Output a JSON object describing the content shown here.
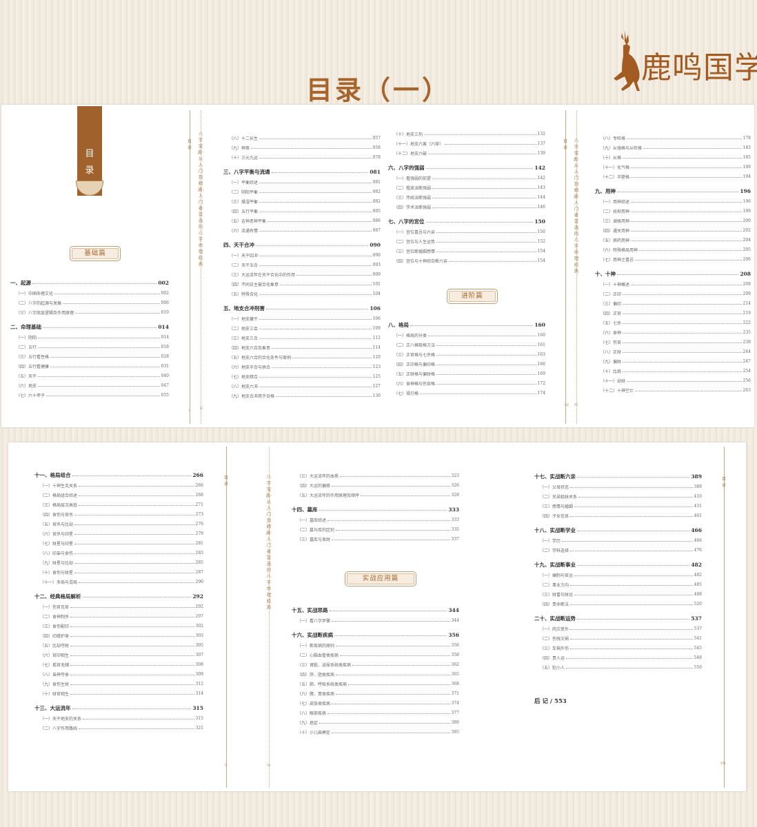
{
  "brand": {
    "name": "鹿鸣国学",
    "logo": "deer-logo-icon"
  },
  "page_title": "目录（一）",
  "category_tab": {
    "line1": "目",
    "line2": "录"
  },
  "spine_tag": "目录",
  "spine_text": "八字宝典·从入门到精通·入门者首选的八字命理经典",
  "page_numbers": [
    "I",
    "II",
    "III",
    "IV",
    "V",
    "VI",
    "VII"
  ],
  "section_badges": {
    "basic": "基础篇",
    "advanced": "进阶篇",
    "practical": "实战应用篇"
  },
  "col1": [
    {
      "t": "h",
      "label": "一、起源",
      "page": "002"
    },
    {
      "t": "s",
      "label": "（一）中国命理文化",
      "page": "002"
    },
    {
      "t": "s",
      "label": "（二）八字的起源与发展",
      "page": "006"
    },
    {
      "t": "s",
      "label": "（三）八字底层逻辑及作用原理",
      "page": "010"
    },
    {
      "t": "h",
      "label": "二、命理基础",
      "page": "014"
    },
    {
      "t": "s",
      "label": "（一）阴阳",
      "page": "014"
    },
    {
      "t": "s",
      "label": "（二）五行",
      "page": "018"
    },
    {
      "t": "s",
      "label": "（三）五行看性格",
      "page": "028"
    },
    {
      "t": "s",
      "label": "（四）五行看健康",
      "page": "031"
    },
    {
      "t": "s",
      "label": "（五）天干",
      "page": "040"
    },
    {
      "t": "s",
      "label": "（六）地支",
      "page": "047"
    },
    {
      "t": "s",
      "label": "（七）六十甲子",
      "page": "055"
    }
  ],
  "col2": [
    {
      "t": "s",
      "label": "（八）十二长生",
      "page": "057"
    },
    {
      "t": "s",
      "label": "（九）神煞",
      "page": "058"
    },
    {
      "t": "s",
      "label": "（十）三元九运",
      "page": "078"
    },
    {
      "t": "h",
      "label": "三、八字平衡与流通",
      "page": "081"
    },
    {
      "t": "s",
      "label": "（一）平衡综述",
      "page": "081"
    },
    {
      "t": "s",
      "label": "（二）阴阳平衡",
      "page": "082"
    },
    {
      "t": "s",
      "label": "（三）燥湿平衡",
      "page": "082"
    },
    {
      "t": "s",
      "label": "（四）五行平衡",
      "page": "085"
    },
    {
      "t": "s",
      "label": "（五）吉神恶神平衡",
      "page": "086"
    },
    {
      "t": "s",
      "label": "（六）流通有情",
      "page": "087"
    },
    {
      "t": "h",
      "label": "四、天干合冲",
      "page": "090"
    },
    {
      "t": "s",
      "label": "（一）天干四冲",
      "page": "090"
    },
    {
      "t": "s",
      "label": "（二）天干五合",
      "page": "093"
    },
    {
      "t": "s",
      "label": "（三）大运流年在天干合化中的作用",
      "page": "099"
    },
    {
      "t": "s",
      "label": "（四）不同日主被合化象意",
      "page": "101"
    },
    {
      "t": "s",
      "label": "（五）特殊合化",
      "page": "104"
    },
    {
      "t": "h",
      "label": "五、地支合冲刑害",
      "page": "106"
    },
    {
      "t": "s",
      "label": "（一）地支藏干",
      "page": "106"
    },
    {
      "t": "s",
      "label": "（二）地支三会",
      "page": "109"
    },
    {
      "t": "s",
      "label": "（三）地支三合",
      "page": "112"
    },
    {
      "t": "s",
      "label": "（四）地支六合及象意",
      "page": "114"
    },
    {
      "t": "s",
      "label": "（五）地支六合的合化条件与案例",
      "page": "120"
    },
    {
      "t": "s",
      "label": "（六）地支半合与拱合",
      "page": "123"
    },
    {
      "t": "s",
      "label": "（七）地支暗合",
      "page": "125"
    },
    {
      "t": "s",
      "label": "（八）地支六冲",
      "page": "127"
    },
    {
      "t": "s",
      "label": "（九）地支合冲用于合格",
      "page": "130"
    }
  ],
  "col3a": [
    {
      "t": "s",
      "label": "（十）地支三刑",
      "page": "132"
    },
    {
      "t": "s",
      "label": "（十一）地支六害（六穿）",
      "page": "137"
    },
    {
      "t": "s",
      "label": "（十二）地支六破",
      "page": "139"
    },
    {
      "t": "h",
      "label": "六、八字的强弱",
      "page": "142"
    },
    {
      "t": "s",
      "label": "（一）看强弱的前提",
      "page": "142"
    },
    {
      "t": "s",
      "label": "（二）粗放派断强弱",
      "page": "143"
    },
    {
      "t": "s",
      "label": "（三）传统派断强弱",
      "page": "144"
    },
    {
      "t": "s",
      "label": "（四）学术派断强弱",
      "page": "146"
    },
    {
      "t": "h",
      "label": "七、八字的宫位",
      "page": "150"
    },
    {
      "t": "s",
      "label": "（一）宫位喜忌与六亲",
      "page": "150"
    },
    {
      "t": "s",
      "label": "（二）宫位与人生运势",
      "page": "152"
    },
    {
      "t": "s",
      "label": "（三）宫位断婚姻感情",
      "page": "154"
    },
    {
      "t": "s",
      "label": "（四）宫位与十神综合断六亲",
      "page": "154"
    }
  ],
  "col3b": [
    {
      "t": "h",
      "label": "八、格局",
      "page": "160"
    },
    {
      "t": "s",
      "label": "（一）格局的分类",
      "page": "160"
    },
    {
      "t": "s",
      "label": "（二）正八格取格方法",
      "page": "161"
    },
    {
      "t": "s",
      "label": "（三）正官格与七杀格",
      "page": "163"
    },
    {
      "t": "s",
      "label": "（四）正印格与偏印格",
      "page": "166"
    },
    {
      "t": "s",
      "label": "（五）正财格与偏财格",
      "page": "169"
    },
    {
      "t": "s",
      "label": "（六）食神格与伤官格",
      "page": "172"
    },
    {
      "t": "s",
      "label": "（七）禄刃格",
      "page": "174"
    }
  ],
  "col4": [
    {
      "t": "s",
      "label": "（八）专旺格",
      "page": "178"
    },
    {
      "t": "s",
      "label": "（九）从强格与从旺格",
      "page": "183"
    },
    {
      "t": "s",
      "label": "（十）从格",
      "page": "185"
    },
    {
      "t": "s",
      "label": "（十一）化气格",
      "page": "189"
    },
    {
      "t": "s",
      "label": "（十二）半壁格",
      "page": "194"
    },
    {
      "t": "h",
      "label": "九、用神",
      "page": "196"
    },
    {
      "t": "s",
      "label": "（一）用神综述",
      "page": "196"
    },
    {
      "t": "s",
      "label": "（二）扶抑用神",
      "page": "199"
    },
    {
      "t": "s",
      "label": "（三）调候用神",
      "page": "200"
    },
    {
      "t": "s",
      "label": "（四）通关用神",
      "page": "202"
    },
    {
      "t": "s",
      "label": "（五）病药用神",
      "page": "204"
    },
    {
      "t": "s",
      "label": "（六）特殊格局用神",
      "page": "205"
    },
    {
      "t": "s",
      "label": "（七）用神之喜忌",
      "page": "206"
    },
    {
      "t": "h",
      "label": "十、十神",
      "page": "208"
    },
    {
      "t": "s",
      "label": "（一）十神概述",
      "page": "208"
    },
    {
      "t": "s",
      "label": "（二）正印",
      "page": "209"
    },
    {
      "t": "s",
      "label": "（三）偏印",
      "page": "214"
    },
    {
      "t": "s",
      "label": "（四）正官",
      "page": "219"
    },
    {
      "t": "s",
      "label": "（五）七杀",
      "page": "222"
    },
    {
      "t": "s",
      "label": "（六）食神",
      "page": "235"
    },
    {
      "t": "s",
      "label": "（七）伤官",
      "page": "238"
    },
    {
      "t": "s",
      "label": "（八）正财",
      "page": "244"
    },
    {
      "t": "s",
      "label": "（九）偏财",
      "page": "247"
    },
    {
      "t": "s",
      "label": "（十）比肩",
      "page": "254"
    },
    {
      "t": "s",
      "label": "（十一）劫财",
      "page": "256"
    },
    {
      "t": "s",
      "label": "（十二）十神空亡",
      "page": "263"
    }
  ],
  "col5": [
    {
      "t": "h",
      "label": "十一、格局组合",
      "page": "266"
    },
    {
      "t": "s",
      "label": "（一）十神生克关系",
      "page": "266"
    },
    {
      "t": "s",
      "label": "（二）格局组合综述",
      "page": "268"
    },
    {
      "t": "s",
      "label": "（三）格局层次高低",
      "page": "271"
    },
    {
      "t": "s",
      "label": "（四）食伤与官杀",
      "page": "273"
    },
    {
      "t": "s",
      "label": "（五）官杀与比劫",
      "page": "276"
    },
    {
      "t": "s",
      "label": "（六）官杀与印星",
      "page": "279"
    },
    {
      "t": "s",
      "label": "（七）财星与印星",
      "page": "281"
    },
    {
      "t": "s",
      "label": "（八）印枭与食伤",
      "page": "283"
    },
    {
      "t": "s",
      "label": "（九）财星与比劫",
      "page": "285"
    },
    {
      "t": "s",
      "label": "（十）食伤与财星",
      "page": "287"
    },
    {
      "t": "s",
      "label": "（十一）多局与混局",
      "page": "290"
    },
    {
      "t": "h",
      "label": "十二、经典格局解析",
      "page": "292"
    },
    {
      "t": "s",
      "label": "（一）伤官见官",
      "page": "292"
    },
    {
      "t": "s",
      "label": "（二）食神制杀",
      "page": "297"
    },
    {
      "t": "s",
      "label": "（三）食伤配印",
      "page": "302"
    },
    {
      "t": "s",
      "label": "（四）印绶护身",
      "page": "303"
    },
    {
      "t": "s",
      "label": "（五）比劫夺财",
      "page": "305"
    },
    {
      "t": "s",
      "label": "（六）官印相生",
      "page": "307"
    },
    {
      "t": "s",
      "label": "（七）孤官无辅",
      "page": "308"
    },
    {
      "t": "s",
      "label": "（八）枭神夺食",
      "page": "309"
    },
    {
      "t": "s",
      "label": "（九）食伤生财",
      "page": "312"
    },
    {
      "t": "s",
      "label": "（十）财官相生",
      "page": "314"
    },
    {
      "t": "h",
      "label": "十三、大运流年",
      "page": "315"
    },
    {
      "t": "s",
      "label": "（一）天干地支的关系",
      "page": "315"
    },
    {
      "t": "s",
      "label": "（二）八字作用路线",
      "page": "321"
    }
  ],
  "col6a": [
    {
      "t": "s",
      "label": "（三）大运流年的本质",
      "page": "323"
    },
    {
      "t": "s",
      "label": "（四）大运的偏移",
      "page": "326"
    },
    {
      "t": "s",
      "label": "（五）大运流年的作用原理及顺序",
      "page": "328"
    },
    {
      "t": "h",
      "label": "十四、墓库",
      "page": "333"
    },
    {
      "t": "s",
      "label": "（一）墓库综述",
      "page": "333"
    },
    {
      "t": "s",
      "label": "（二）墓与库的区别",
      "page": "335"
    },
    {
      "t": "s",
      "label": "（三）墓库与发财",
      "page": "337"
    }
  ],
  "col6b": [
    {
      "t": "h",
      "label": "十五、实战思路",
      "page": "344"
    },
    {
      "t": "s",
      "label": "（一）看八字步骤",
      "page": "344"
    },
    {
      "t": "h",
      "label": "十六、实战断疾病",
      "page": "356"
    },
    {
      "t": "s",
      "label": "（一）断疾病的原则",
      "page": "356"
    },
    {
      "t": "s",
      "label": "（二）心脑血管类疾病",
      "page": "358"
    },
    {
      "t": "s",
      "label": "（三）肾脏、泌尿系统类疾病",
      "page": "362"
    },
    {
      "t": "s",
      "label": "（四）肝、胆类疾病",
      "page": "365"
    },
    {
      "t": "s",
      "label": "（五）肺、呼吸系统类疾病",
      "page": "368"
    },
    {
      "t": "s",
      "label": "（六）脾、胃类疾病",
      "page": "371"
    },
    {
      "t": "s",
      "label": "（七）皮肤类疾病",
      "page": "374"
    },
    {
      "t": "s",
      "label": "（八）眼部疾病",
      "page": "377"
    },
    {
      "t": "s",
      "label": "（九）癌症",
      "page": "380"
    },
    {
      "t": "s",
      "label": "（十）小儿麻痹症",
      "page": "385"
    }
  ],
  "col7": [
    {
      "t": "h",
      "label": "十七、实战断六亲",
      "page": "389"
    },
    {
      "t": "s",
      "label": "（一）父母状态",
      "page": "389"
    },
    {
      "t": "s",
      "label": "（二）兄弟姐妹关系",
      "page": "410"
    },
    {
      "t": "s",
      "label": "（三）感情与婚姻",
      "page": "431"
    },
    {
      "t": "s",
      "label": "（四）子女信息",
      "page": "461"
    },
    {
      "t": "h",
      "label": "十八、实战断学业",
      "page": "466"
    },
    {
      "t": "s",
      "label": "（一）学历",
      "page": "466"
    },
    {
      "t": "s",
      "label": "（二）学科选择",
      "page": "476"
    },
    {
      "t": "h",
      "label": "十九、实战断事业",
      "page": "482"
    },
    {
      "t": "s",
      "label": "（一）编制与官运",
      "page": "482"
    },
    {
      "t": "s",
      "label": "（二）事业方向",
      "page": "485"
    },
    {
      "t": "s",
      "label": "（三）财富与财运",
      "page": "488"
    },
    {
      "t": "s",
      "label": "（四）贵命断法",
      "page": "520"
    },
    {
      "t": "h",
      "label": "二十、实战断运势",
      "page": "537"
    },
    {
      "t": "s",
      "label": "（一）肉灾意外",
      "page": "537"
    },
    {
      "t": "s",
      "label": "（二）伤残灾祸",
      "page": "541"
    },
    {
      "t": "s",
      "label": "（三）车祸外伤",
      "page": "545"
    },
    {
      "t": "s",
      "label": "（四）贵人运",
      "page": "548"
    },
    {
      "t": "s",
      "label": "（五）犯小人",
      "page": "550"
    }
  ],
  "afterword": "后  记 / 553"
}
